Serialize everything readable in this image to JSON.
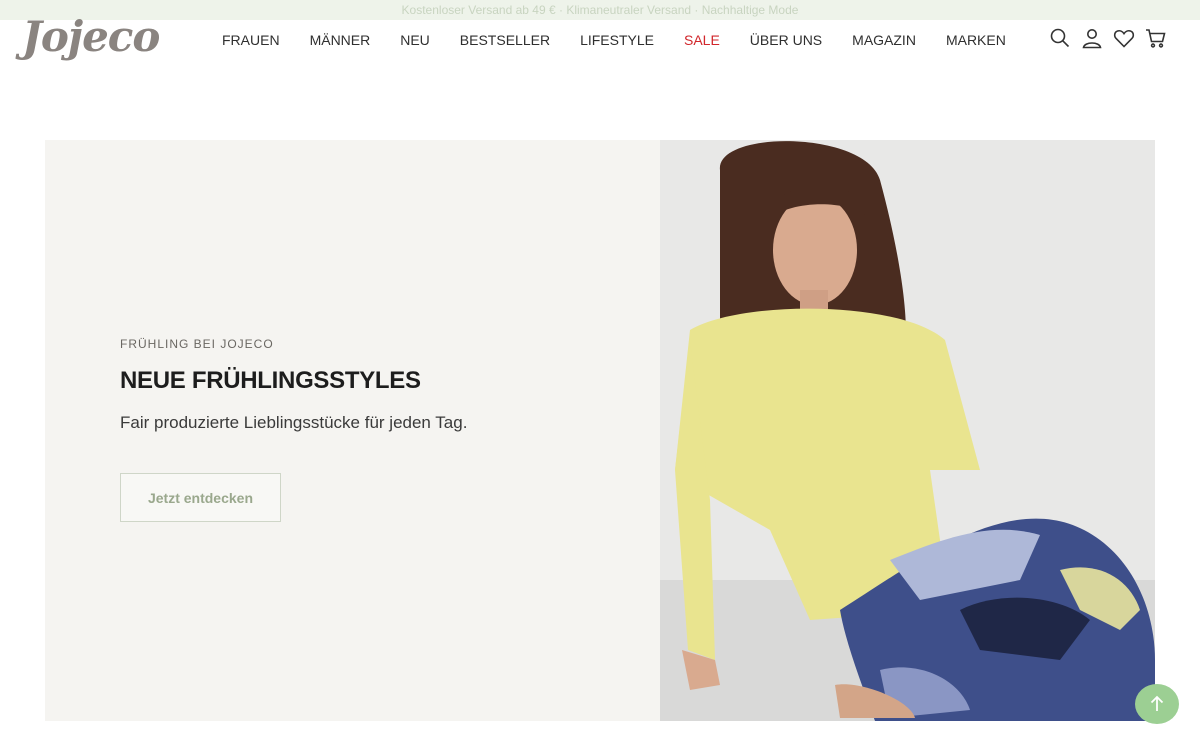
{
  "topbar": {
    "text": "Kostenloser Versand ab 49 € · Klimaneutraler Versand · Nachhaltige Mode"
  },
  "brand": {
    "logo": "Jojeco"
  },
  "nav": [
    {
      "label": "FRAUEN"
    },
    {
      "label": "MÄNNER"
    },
    {
      "label": "NEU"
    },
    {
      "label": "BESTSELLER"
    },
    {
      "label": "LIFESTYLE"
    },
    {
      "label": "SALE",
      "color": "#d1262b"
    },
    {
      "label": "ÜBER UNS"
    },
    {
      "label": "MAGAZIN"
    },
    {
      "label": "MARKEN"
    }
  ],
  "header_icons": [
    "search-icon",
    "user-icon",
    "heart-icon",
    "cart-icon"
  ],
  "hero": {
    "eyebrow": "FRÜHLING BEI JOJECO",
    "headline": "NEUE FRÜHLINGSSTYLES",
    "subline": "Fair produzierte Lieblingsstücke für jeden Tag.",
    "cta_label": "Jetzt entdecken"
  },
  "colors": {
    "accent_green": "#9ccf93",
    "sale_red": "#d1262b",
    "hero_bg": "#f5f4f1",
    "topbar_bg": "#eef3ea"
  }
}
